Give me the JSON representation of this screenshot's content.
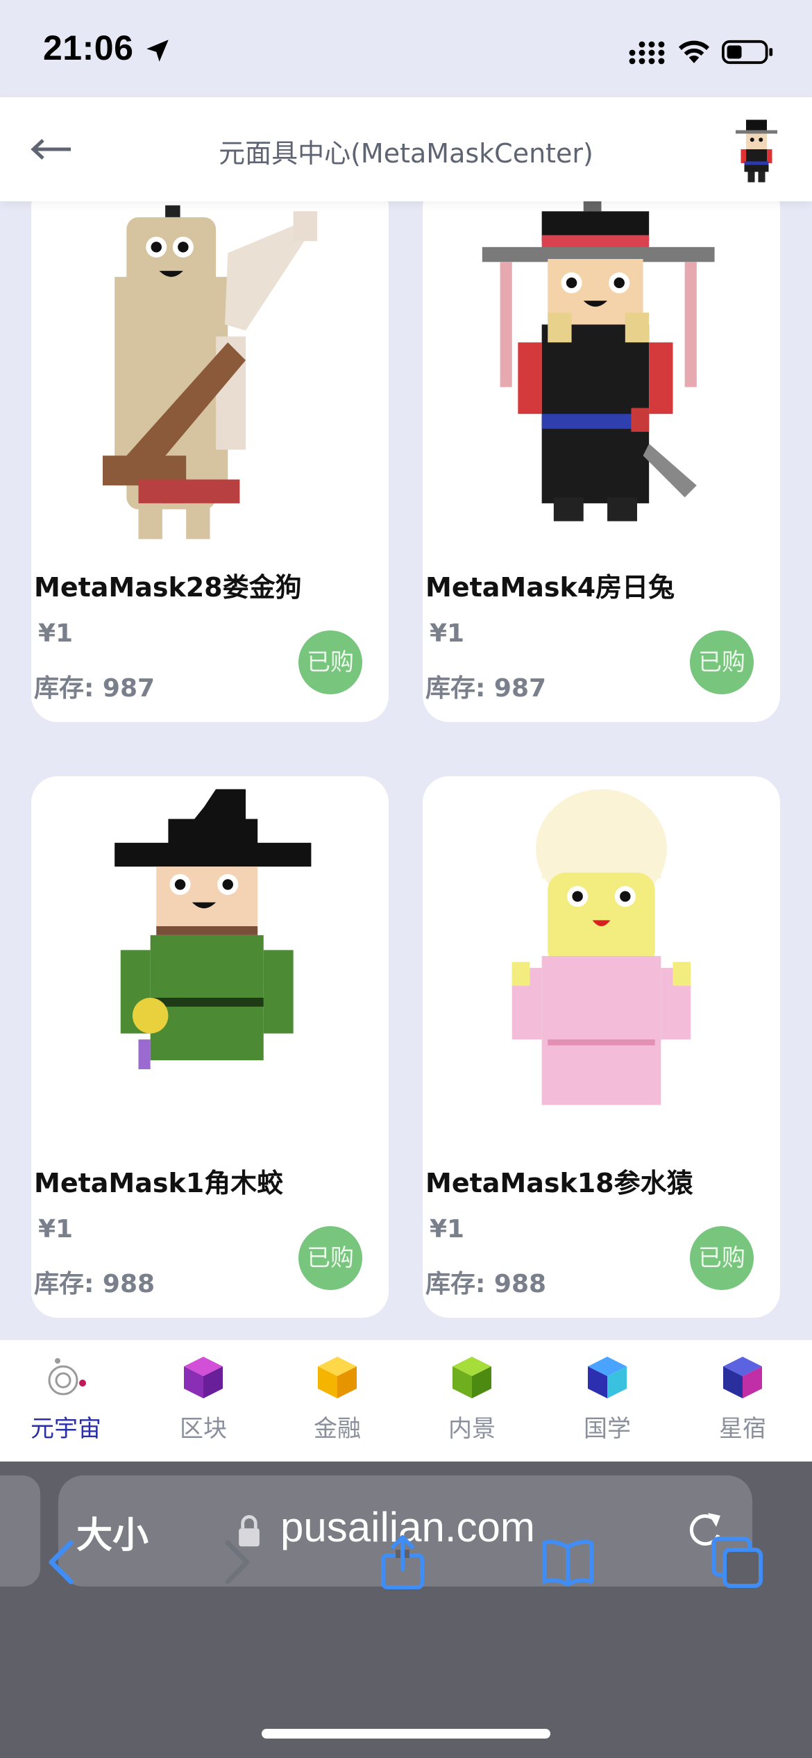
{
  "status_bar": {
    "time": "21:06"
  },
  "header": {
    "title": "元面具中心(MetaMaskCenter)"
  },
  "products": [
    {
      "name": "MetaMask28娄金狗",
      "price": "¥1",
      "stock": "库存: 987",
      "badge": "已购",
      "image": "dog-mask"
    },
    {
      "name": "MetaMask4房日兔",
      "price": "¥1",
      "stock": "库存: 987",
      "badge": "已购",
      "image": "rabbit-mask"
    },
    {
      "name": "MetaMask1角木蛟",
      "price": "¥1",
      "stock": "库存: 988",
      "badge": "已购",
      "image": "dragon-mask"
    },
    {
      "name": "MetaMask18参水猿",
      "price": "¥1",
      "stock": "库存: 988",
      "badge": "已购",
      "image": "ape-mask"
    }
  ],
  "tabbar": {
    "items": [
      {
        "label": "元宇宙",
        "icon": "orbit-icon",
        "active": true
      },
      {
        "label": "区块",
        "icon": "purple-cube-icon"
      },
      {
        "label": "金融",
        "icon": "gold-cube-icon"
      },
      {
        "label": "内景",
        "icon": "green-cube-icon"
      },
      {
        "label": "国学",
        "icon": "blue-cube-icon"
      },
      {
        "label": "星宿",
        "icon": "indigo-cube-icon"
      }
    ]
  },
  "safari": {
    "text_size_label": "大小",
    "url": "pusailian.com"
  },
  "colors": {
    "page_bg": "#e6e8f5",
    "badge": "#78c57e",
    "active_tab": "#2a2fa8",
    "safari_blue": "#3f8df5"
  }
}
